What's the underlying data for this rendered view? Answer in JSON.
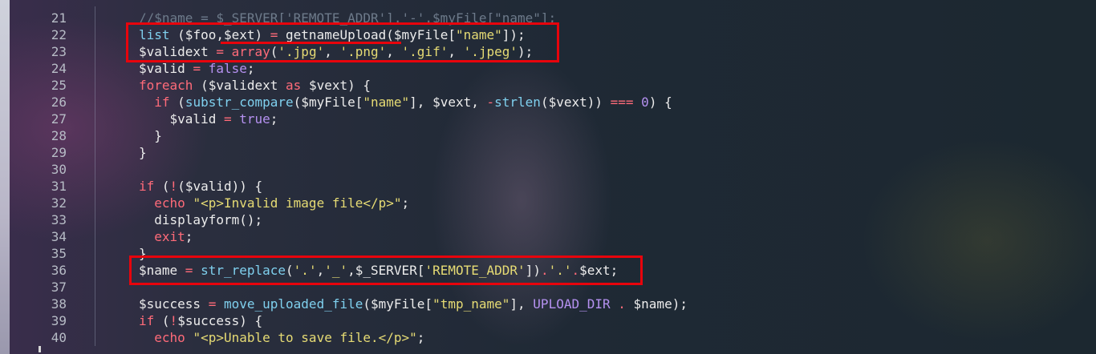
{
  "editor": {
    "lines": [
      {
        "num": "21",
        "tokens": [
          {
            "t": "//$name = $_SERVER['REMOTE_ADDR'].'-'.$myFile[\"name\"];",
            "c": "dim"
          }
        ]
      },
      {
        "num": "22",
        "tokens": [
          {
            "t": "list ",
            "c": "f"
          },
          {
            "t": "($foo,$ext) ",
            "c": ""
          },
          {
            "t": "= ",
            "c": "k"
          },
          {
            "t": "getnameUpload",
            "c": ""
          },
          {
            "t": "($myFile[",
            "c": ""
          },
          {
            "t": "\"name\"",
            "c": "s"
          },
          {
            "t": "]);",
            "c": ""
          }
        ]
      },
      {
        "num": "23",
        "tokens": [
          {
            "t": "$validext ",
            "c": ""
          },
          {
            "t": "= ",
            "c": "k"
          },
          {
            "t": "array",
            "c": "k"
          },
          {
            "t": "(",
            "c": ""
          },
          {
            "t": "'.jpg'",
            "c": "s"
          },
          {
            "t": ", ",
            "c": ""
          },
          {
            "t": "'.png'",
            "c": "s"
          },
          {
            "t": ", ",
            "c": ""
          },
          {
            "t": "'.gif'",
            "c": "s"
          },
          {
            "t": ", ",
            "c": ""
          },
          {
            "t": "'.jpeg'",
            "c": "s"
          },
          {
            "t": ");",
            "c": ""
          }
        ]
      },
      {
        "num": "24",
        "tokens": [
          {
            "t": "$valid ",
            "c": ""
          },
          {
            "t": "= ",
            "c": "k"
          },
          {
            "t": "false",
            "c": "n"
          },
          {
            "t": ";",
            "c": ""
          }
        ]
      },
      {
        "num": "25",
        "tokens": [
          {
            "t": "foreach ",
            "c": "k"
          },
          {
            "t": "($validext ",
            "c": ""
          },
          {
            "t": "as ",
            "c": "k"
          },
          {
            "t": "$vext) {",
            "c": ""
          }
        ]
      },
      {
        "num": "26",
        "tokens": [
          {
            "t": "  if ",
            "c": "k"
          },
          {
            "t": "(",
            "c": ""
          },
          {
            "t": "substr_compare",
            "c": "f"
          },
          {
            "t": "($myFile[",
            "c": ""
          },
          {
            "t": "\"name\"",
            "c": "s"
          },
          {
            "t": "], $vext, ",
            "c": ""
          },
          {
            "t": "-",
            "c": "k"
          },
          {
            "t": "strlen",
            "c": "f"
          },
          {
            "t": "($vext)) ",
            "c": ""
          },
          {
            "t": "=== ",
            "c": "k"
          },
          {
            "t": "0",
            "c": "n"
          },
          {
            "t": ") {",
            "c": ""
          }
        ]
      },
      {
        "num": "27",
        "tokens": [
          {
            "t": "    $valid ",
            "c": ""
          },
          {
            "t": "= ",
            "c": "k"
          },
          {
            "t": "true",
            "c": "n"
          },
          {
            "t": ";",
            "c": ""
          }
        ]
      },
      {
        "num": "28",
        "tokens": [
          {
            "t": "  }",
            "c": ""
          }
        ]
      },
      {
        "num": "29",
        "tokens": [
          {
            "t": "}",
            "c": ""
          }
        ]
      },
      {
        "num": "30",
        "tokens": []
      },
      {
        "num": "31",
        "tokens": [
          {
            "t": "if ",
            "c": "k"
          },
          {
            "t": "(",
            "c": ""
          },
          {
            "t": "!",
            "c": "k"
          },
          {
            "t": "($valid)) {",
            "c": ""
          }
        ]
      },
      {
        "num": "32",
        "tokens": [
          {
            "t": "  echo ",
            "c": "k"
          },
          {
            "t": "\"<p>Invalid image file</p>\"",
            "c": "s"
          },
          {
            "t": ";",
            "c": ""
          }
        ]
      },
      {
        "num": "33",
        "tokens": [
          {
            "t": "  displayform();",
            "c": ""
          }
        ]
      },
      {
        "num": "34",
        "tokens": [
          {
            "t": "  exit",
            "c": "k"
          },
          {
            "t": ";",
            "c": ""
          }
        ]
      },
      {
        "num": "35",
        "tokens": [
          {
            "t": "}",
            "c": ""
          }
        ]
      },
      {
        "num": "36",
        "tokens": [
          {
            "t": "$name ",
            "c": ""
          },
          {
            "t": "= ",
            "c": "k"
          },
          {
            "t": "str_replace",
            "c": "f"
          },
          {
            "t": "(",
            "c": ""
          },
          {
            "t": "'.'",
            "c": "s"
          },
          {
            "t": ",",
            "c": ""
          },
          {
            "t": "'_'",
            "c": "s"
          },
          {
            "t": ",$_SERVER[",
            "c": ""
          },
          {
            "t": "'REMOTE_ADDR'",
            "c": "s"
          },
          {
            "t": "])",
            "c": ""
          },
          {
            "t": ".",
            "c": "k"
          },
          {
            "t": "'.'",
            "c": "s"
          },
          {
            "t": ".",
            "c": "k"
          },
          {
            "t": "$ext;",
            "c": ""
          }
        ]
      },
      {
        "num": "37",
        "tokens": []
      },
      {
        "num": "38",
        "tokens": [
          {
            "t": "$success ",
            "c": ""
          },
          {
            "t": "= ",
            "c": "k"
          },
          {
            "t": "move_uploaded_file",
            "c": "f"
          },
          {
            "t": "($myFile[",
            "c": ""
          },
          {
            "t": "\"tmp_name\"",
            "c": "s"
          },
          {
            "t": "], ",
            "c": ""
          },
          {
            "t": "UPLOAD_DIR ",
            "c": "n"
          },
          {
            "t": ". ",
            "c": "k"
          },
          {
            "t": "$name);",
            "c": ""
          }
        ]
      },
      {
        "num": "39",
        "tokens": [
          {
            "t": "if ",
            "c": "k"
          },
          {
            "t": "(",
            "c": ""
          },
          {
            "t": "!",
            "c": "k"
          },
          {
            "t": "$success) {",
            "c": ""
          }
        ]
      },
      {
        "num": "40",
        "tokens": [
          {
            "t": "  echo ",
            "c": "k"
          },
          {
            "t": "\"<p>Unable to save file.</p>\"",
            "c": "s"
          },
          {
            "t": ";",
            "c": ""
          }
        ]
      }
    ]
  },
  "colors": {
    "annotation": "#e8040c",
    "keyword": "#ff6b79",
    "string": "#e6db74",
    "function": "#7fd0ee",
    "constant": "#b591f0"
  }
}
